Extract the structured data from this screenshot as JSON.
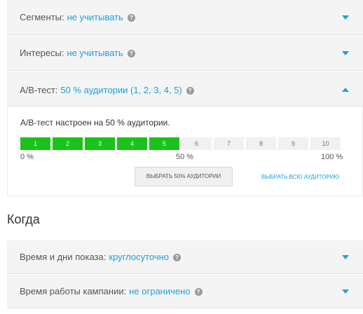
{
  "rows": {
    "segments": {
      "label": "Сегменты:",
      "value": "не учитывать"
    },
    "interests": {
      "label": "Интересы:",
      "value": "не учитывать"
    },
    "ab_test": {
      "label": "А/В-тест:",
      "value": "50 % аудитории (1, 2, 3, 4, 5)"
    }
  },
  "ab_panel": {
    "note": "А/В-тест настроен на 50 % аудитории.",
    "segments": [
      {
        "label": "1",
        "selected": true
      },
      {
        "label": "2",
        "selected": true
      },
      {
        "label": "3",
        "selected": true
      },
      {
        "label": "4",
        "selected": true
      },
      {
        "label": "5",
        "selected": true
      },
      {
        "label": "6",
        "selected": false
      },
      {
        "label": "7",
        "selected": false
      },
      {
        "label": "8",
        "selected": false
      },
      {
        "label": "9",
        "selected": false
      },
      {
        "label": "10",
        "selected": false
      }
    ],
    "scale_min": "0 %",
    "scale_mid": "50 %",
    "scale_max": "100 %",
    "button_label": "ВЫБРАТЬ 50% АУДИТОРИИ",
    "link_label": "ВЫБРАТЬ ВСЮ АУДИТОРИЮ"
  },
  "when": {
    "title": "Когда",
    "schedule": {
      "label": "Время и дни показа:",
      "value": "круглосуточно"
    },
    "duration": {
      "label": "Время работы кампании:",
      "value": "не ограничено"
    }
  },
  "icons": {
    "help": "question-circle-icon",
    "expand": "chevron-down-icon",
    "collapse": "chevron-up-icon"
  },
  "colors": {
    "accent": "#1aa1dc",
    "selected_segment": "#19c319"
  }
}
